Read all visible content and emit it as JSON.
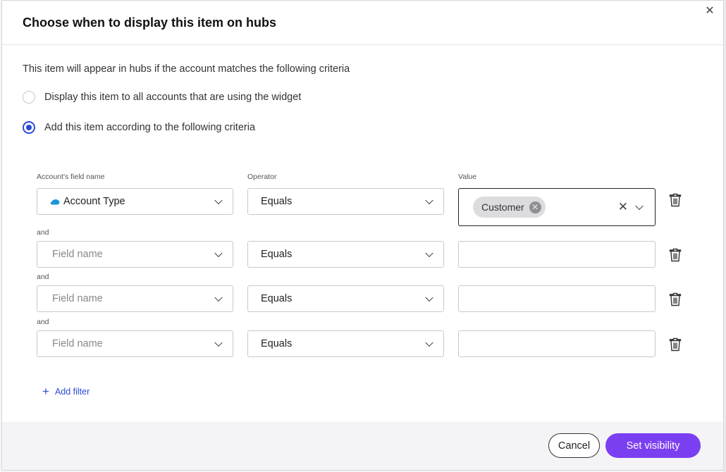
{
  "modal": {
    "title": "Choose when to display this item on hubs",
    "intro": "This item will appear in hubs if the account matches the following criteria",
    "options": [
      {
        "label": "Display this item to all accounts that are using the widget",
        "selected": false
      },
      {
        "label": "Add this item according to the following criteria",
        "selected": true
      }
    ]
  },
  "criteria": {
    "headers": {
      "field": "Account's field name",
      "operator": "Operator",
      "value": "Value"
    },
    "connector": "and",
    "field_placeholder": "Field name",
    "rows": [
      {
        "field": "Account Type",
        "field_icon": "salesforce-cloud-icon",
        "operator": "Equals",
        "values": [
          "Customer"
        ]
      },
      {
        "field": "",
        "operator": "Equals",
        "values": []
      },
      {
        "field": "",
        "operator": "Equals",
        "values": []
      },
      {
        "field": "",
        "operator": "Equals",
        "values": []
      }
    ],
    "add_filter": "Add filter"
  },
  "footer": {
    "cancel": "Cancel",
    "submit": "Set visibility"
  },
  "colors": {
    "accent": "#2b4ad6",
    "primary_button": "#7b3ff2",
    "chip": "#dcdcdf"
  }
}
